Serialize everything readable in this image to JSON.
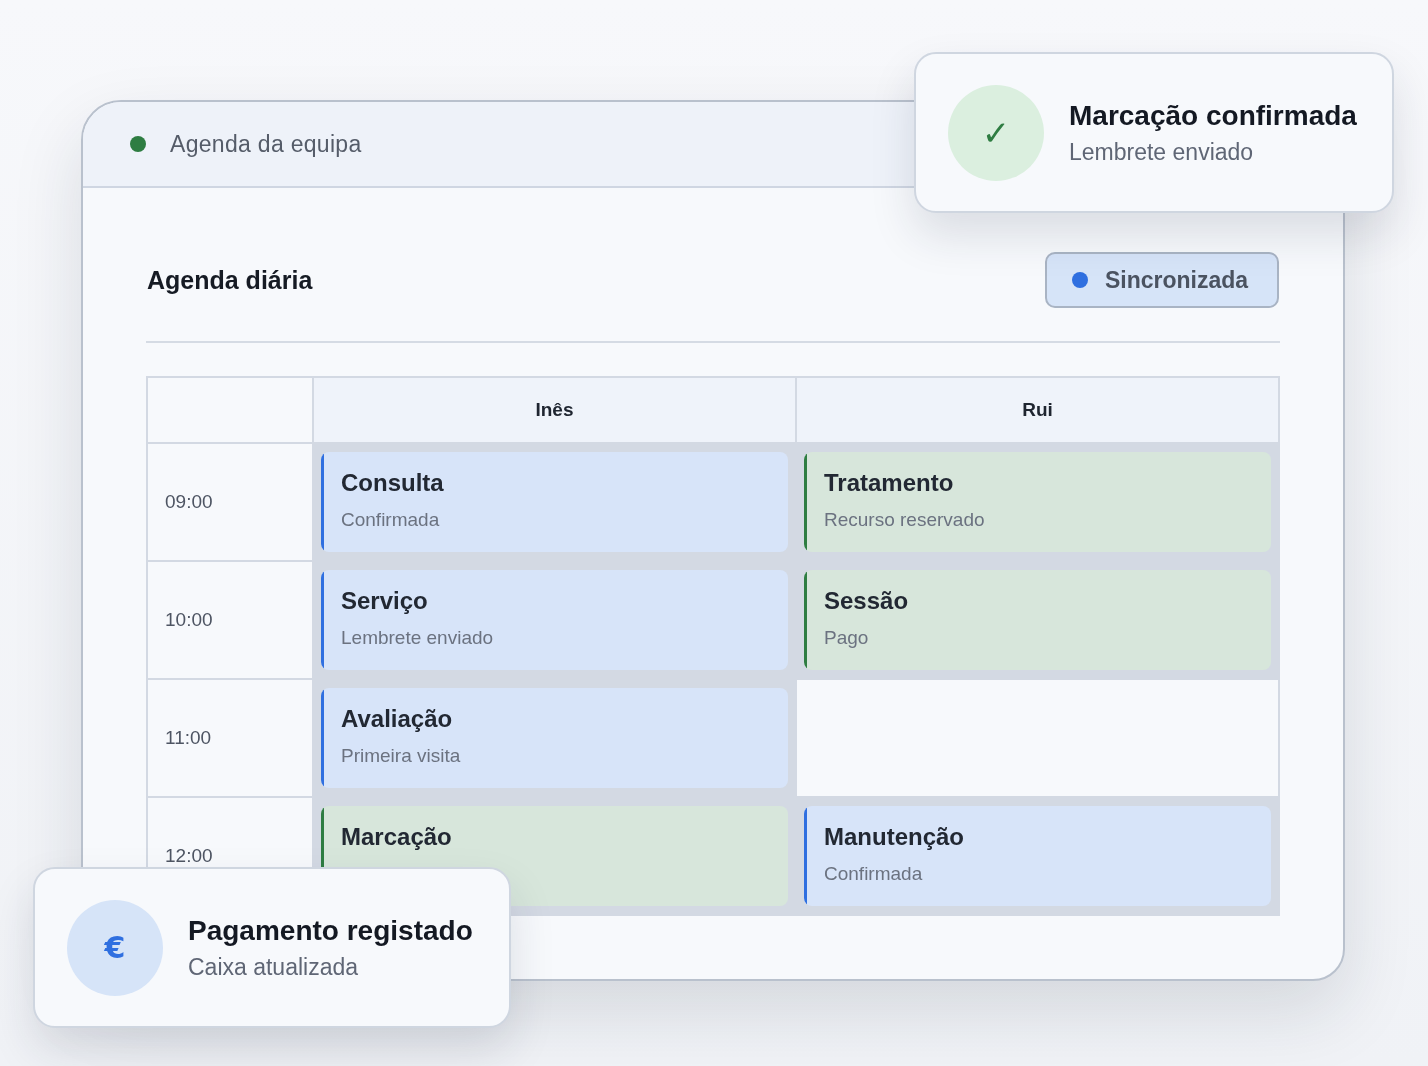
{
  "window": {
    "title": "Agenda da equipa"
  },
  "agenda": {
    "title": "Agenda diária",
    "sync_status": "Sincronizada"
  },
  "schedule": {
    "columns": [
      "Inês",
      "Rui"
    ],
    "rows": [
      {
        "time": "09:00",
        "slots": [
          {
            "booked": true,
            "title": "Consulta",
            "subtitle": "Confirmada",
            "color": "#2f6fe0"
          },
          {
            "booked": true,
            "title": "Tratamento",
            "subtitle": "Recurso reservado",
            "color": "#2e7d42"
          }
        ]
      },
      {
        "time": "10:00",
        "slots": [
          {
            "booked": true,
            "title": "Serviço",
            "subtitle": "Lembrete enviado",
            "color": "#2f6fe0"
          },
          {
            "booked": true,
            "title": "Sessão",
            "subtitle": "Pago",
            "color": "#2e7d42"
          }
        ]
      },
      {
        "time": "11:00",
        "slots": [
          {
            "booked": true,
            "title": "Avaliação",
            "subtitle": "Primeira visita",
            "color": "#2f6fe0"
          },
          {
            "booked": false
          }
        ]
      },
      {
        "time": "12:00",
        "slots": [
          {
            "booked": true,
            "title": "Marcação",
            "color": "#2e7d42"
          },
          {
            "booked": true,
            "title": "Manutenção",
            "subtitle": "Confirmada",
            "color": "#2f6fe0"
          }
        ]
      }
    ]
  },
  "notifications": [
    {
      "kind": "confirmation",
      "symbol": "✓",
      "title": "Marcação confirmada",
      "subtitle": "Lembrete enviado"
    },
    {
      "kind": "payment",
      "symbol": "€",
      "title": "Pagamento registado",
      "subtitle": "Caixa atualizada"
    }
  ]
}
